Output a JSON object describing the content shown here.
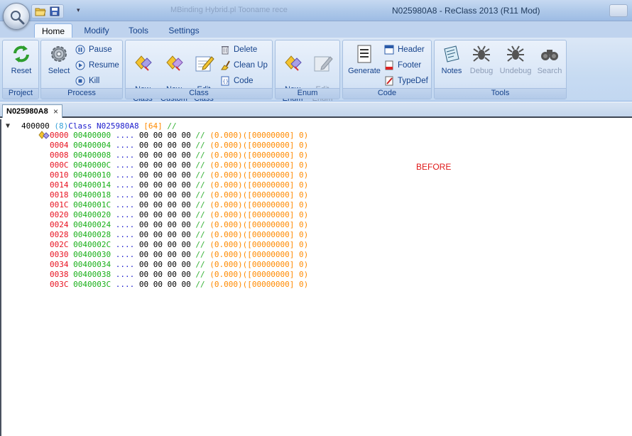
{
  "window": {
    "title": "N025980A8 - ReClass 2013 (R11 Mod)",
    "background_tasks": "MBinding   Hybrid.pl          Tooname rece"
  },
  "ribbon_tabs": [
    "Home",
    "Modify",
    "Tools",
    "Settings"
  ],
  "groups": {
    "project": {
      "label": "Project",
      "reset": "Reset"
    },
    "process": {
      "label": "Process",
      "select": "Select",
      "pause": "Pause",
      "resume": "Resume",
      "kill": "Kill"
    },
    "class": {
      "label": "Class",
      "new_class": "New\nClass",
      "new_custom": "New\nCustom",
      "edit_class": "Edit\nClass",
      "delete": "Delete",
      "clean_up": "Clean Up",
      "code": "Code"
    },
    "enum": {
      "label": "Enum",
      "new_enum": "New\nEnum",
      "edit_enum": "Edit\nEnum"
    },
    "code": {
      "label": "Code",
      "generate": "Generate",
      "header": "Header",
      "footer": "Footer",
      "typedef": "TypeDef"
    },
    "tools": {
      "label": "Tools",
      "notes": "Notes",
      "debug": "Debug",
      "undebug": "Undebug",
      "search": "Search"
    }
  },
  "document_tab": {
    "title": "N025980A8",
    "close": "×"
  },
  "class_header": {
    "address": "400000",
    "count": "(8)",
    "keyword": "Class",
    "name": "N025980A8",
    "size": "[64]",
    "comment": "//"
  },
  "memory_rows": [
    {
      "offset": "0000",
      "address": "00400000",
      "ascii": "....",
      "bytes": "00 00 00 00",
      "comment": "//",
      "value": "(0.000)([00000000] 0)"
    },
    {
      "offset": "0004",
      "address": "00400004",
      "ascii": "....",
      "bytes": "00 00 00 00",
      "comment": "//",
      "value": "(0.000)([00000000] 0)"
    },
    {
      "offset": "0008",
      "address": "00400008",
      "ascii": "....",
      "bytes": "00 00 00 00",
      "comment": "//",
      "value": "(0.000)([00000000] 0)"
    },
    {
      "offset": "000C",
      "address": "0040000C",
      "ascii": "....",
      "bytes": "00 00 00 00",
      "comment": "//",
      "value": "(0.000)([00000000] 0)"
    },
    {
      "offset": "0010",
      "address": "00400010",
      "ascii": "....",
      "bytes": "00 00 00 00",
      "comment": "//",
      "value": "(0.000)([00000000] 0)"
    },
    {
      "offset": "0014",
      "address": "00400014",
      "ascii": "....",
      "bytes": "00 00 00 00",
      "comment": "//",
      "value": "(0.000)([00000000] 0)"
    },
    {
      "offset": "0018",
      "address": "00400018",
      "ascii": "....",
      "bytes": "00 00 00 00",
      "comment": "//",
      "value": "(0.000)([00000000] 0)"
    },
    {
      "offset": "001C",
      "address": "0040001C",
      "ascii": "....",
      "bytes": "00 00 00 00",
      "comment": "//",
      "value": "(0.000)([00000000] 0)"
    },
    {
      "offset": "0020",
      "address": "00400020",
      "ascii": "....",
      "bytes": "00 00 00 00",
      "comment": "//",
      "value": "(0.000)([00000000] 0)"
    },
    {
      "offset": "0024",
      "address": "00400024",
      "ascii": "....",
      "bytes": "00 00 00 00",
      "comment": "//",
      "value": "(0.000)([00000000] 0)"
    },
    {
      "offset": "0028",
      "address": "00400028",
      "ascii": "....",
      "bytes": "00 00 00 00",
      "comment": "//",
      "value": "(0.000)([00000000] 0)"
    },
    {
      "offset": "002C",
      "address": "0040002C",
      "ascii": "....",
      "bytes": "00 00 00 00",
      "comment": "//",
      "value": "(0.000)([00000000] 0)"
    },
    {
      "offset": "0030",
      "address": "00400030",
      "ascii": "....",
      "bytes": "00 00 00 00",
      "comment": "//",
      "value": "(0.000)([00000000] 0)"
    },
    {
      "offset": "0034",
      "address": "00400034",
      "ascii": "....",
      "bytes": "00 00 00 00",
      "comment": "//",
      "value": "(0.000)([00000000] 0)"
    },
    {
      "offset": "0038",
      "address": "00400038",
      "ascii": "....",
      "bytes": "00 00 00 00",
      "comment": "//",
      "value": "(0.000)([00000000] 0)"
    },
    {
      "offset": "003C",
      "address": "0040003C",
      "ascii": "....",
      "bytes": "00 00 00 00",
      "comment": "//",
      "value": "(0.000)([00000000] 0)"
    }
  ],
  "annotation": "BEFORE",
  "colors": {
    "offset": "#e8111f",
    "address": "#18b018",
    "ascii": "#1a1acc",
    "comment": "#36b236",
    "value": "#ff8a00",
    "annotation": "#e01818"
  }
}
